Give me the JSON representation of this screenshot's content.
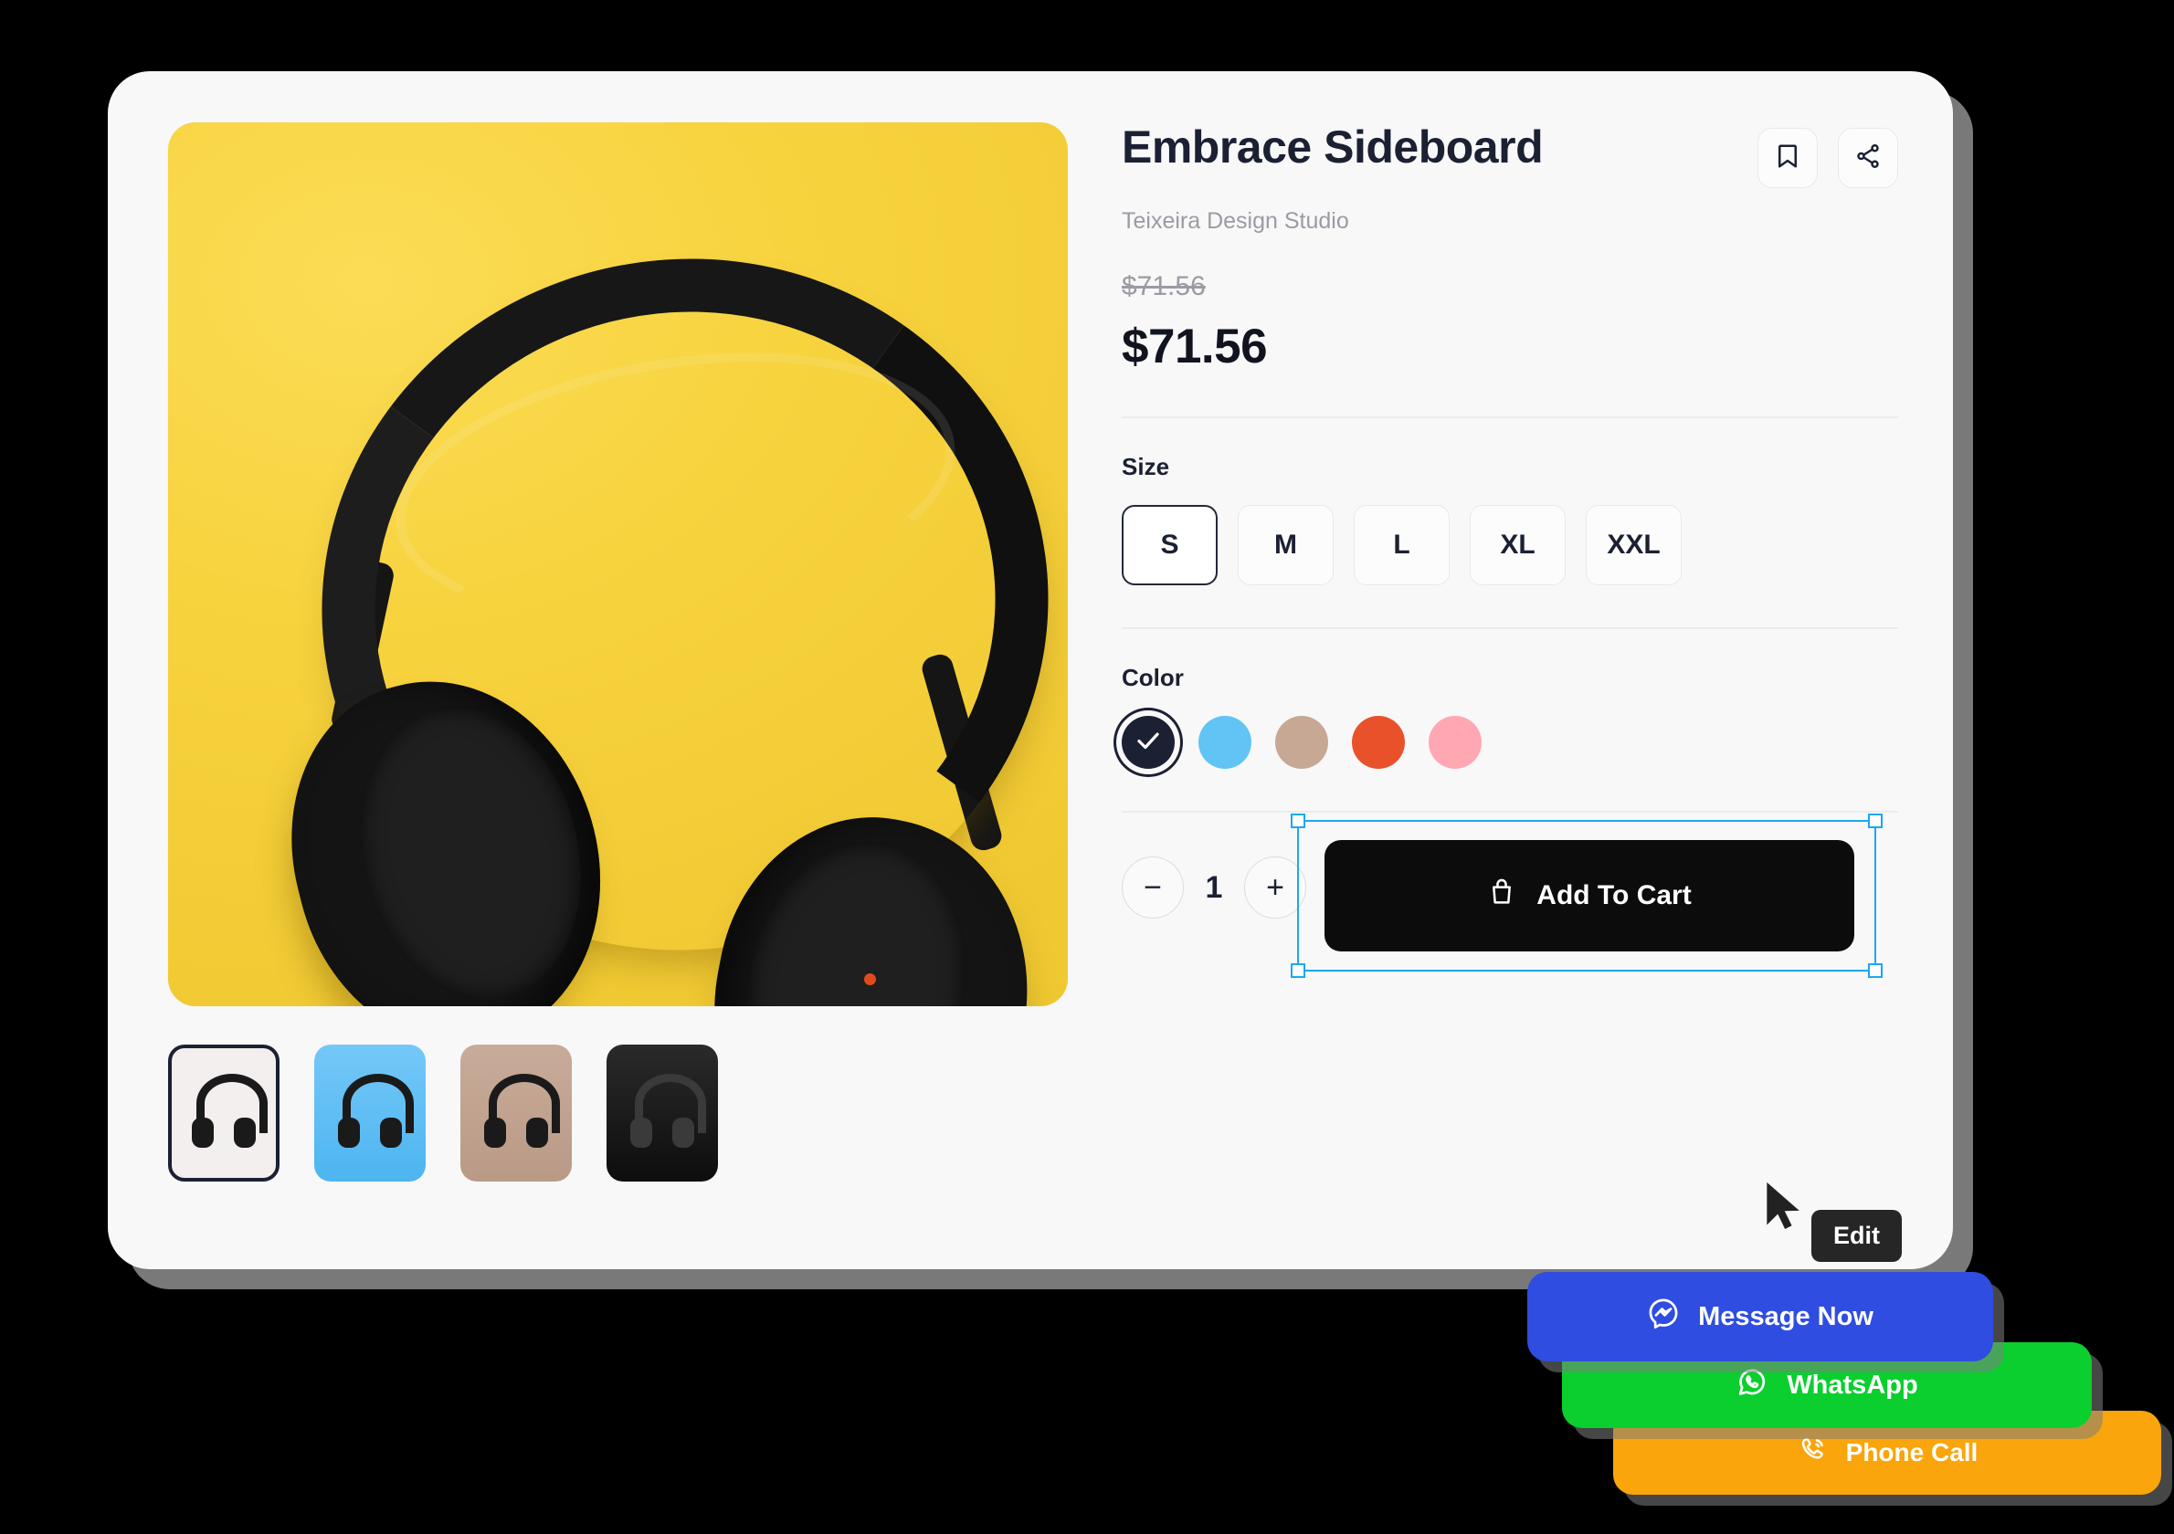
{
  "product": {
    "title": "Embrace Sideboard",
    "brand": "Teixeira Design Studio",
    "old_price": "$71.56",
    "price": "$71.56"
  },
  "header_actions": {
    "bookmark_icon": "bookmark-icon",
    "share_icon": "share-icon"
  },
  "size": {
    "label": "Size",
    "options": [
      {
        "label": "S",
        "selected": true
      },
      {
        "label": "M",
        "selected": false
      },
      {
        "label": "L",
        "selected": false
      },
      {
        "label": "XL",
        "selected": false
      },
      {
        "label": "XXL",
        "selected": false
      }
    ]
  },
  "color": {
    "label": "Color",
    "options": [
      {
        "name": "black",
        "hex": "#1b2033",
        "selected": true
      },
      {
        "name": "sky-blue",
        "hex": "#62c4f5",
        "selected": false
      },
      {
        "name": "tan",
        "hex": "#c6a895",
        "selected": false
      },
      {
        "name": "orange-red",
        "hex": "#e9512b",
        "selected": false
      },
      {
        "name": "pink",
        "hex": "#ffa8b4",
        "selected": false
      }
    ]
  },
  "cart": {
    "decrease_label": "−",
    "quantity": "1",
    "increase_label": "+",
    "add_to_cart_label": "Add To Cart",
    "bag_icon": "shopping-bag-icon"
  },
  "editor": {
    "tooltip_label": "Edit",
    "selection_color": "#1ca7f0",
    "cursor_icon": "mouse-pointer-icon"
  },
  "gallery": {
    "main_image_alt": "black over-ear headphones on yellow background",
    "main_background": "#f7d33e",
    "thumbnails": [
      {
        "alt": "headphones on white background",
        "bg": "#efeceb",
        "selected": true
      },
      {
        "alt": "headphones on blue background",
        "bg": "#4db5f0",
        "selected": false
      },
      {
        "alt": "headphones on tan background",
        "bg": "#b99a86",
        "selected": false
      },
      {
        "alt": "headphones on black background",
        "bg": "#0d0d0d",
        "selected": false
      }
    ]
  },
  "chat_buttons": [
    {
      "label": "Message Now",
      "icon": "messenger-icon",
      "color": "#2f4de0"
    },
    {
      "label": "WhatsApp",
      "icon": "whatsapp-icon",
      "color": "#0acf2e"
    },
    {
      "label": "Phone Call",
      "icon": "phone-icon",
      "color": "#f9a50b"
    }
  ]
}
